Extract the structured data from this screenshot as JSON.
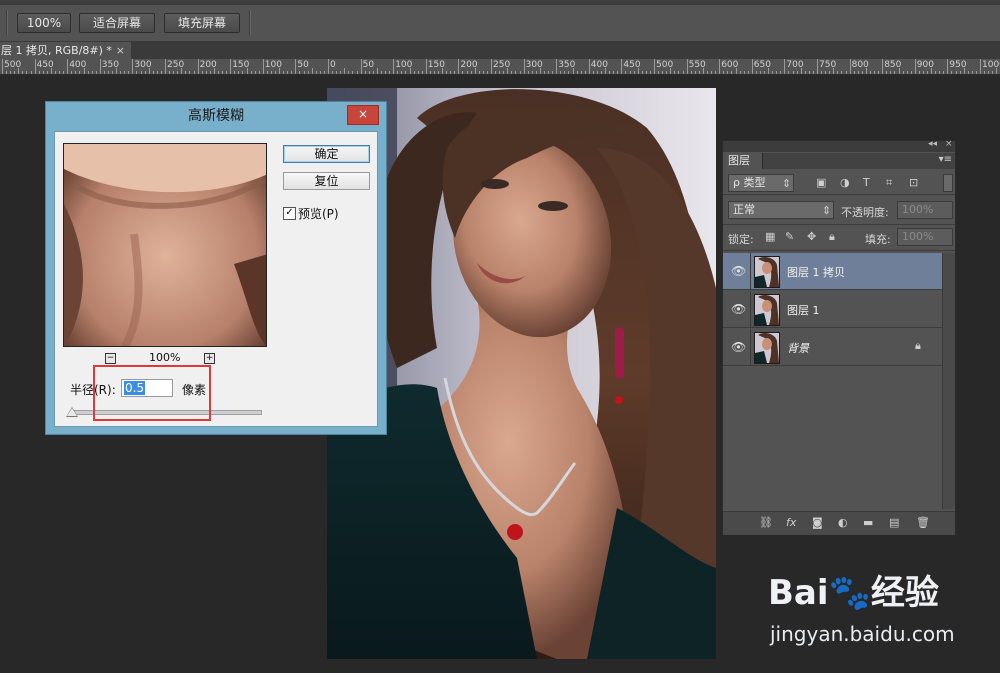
{
  "options_bar": {
    "btn_100": "100%",
    "btn_fit": "适合屏幕",
    "btn_fill": "填充屏幕"
  },
  "doc_tab": {
    "label": "层 1 拷贝, RGB/8#) *",
    "close": "×"
  },
  "ruler": {
    "labels": [
      "500",
      "450",
      "400",
      "350",
      "300",
      "250",
      "200",
      "150",
      "100",
      "50",
      "0",
      "50",
      "100",
      "150",
      "200",
      "250",
      "300",
      "350",
      "400",
      "450",
      "500",
      "550",
      "600",
      "650",
      "700",
      "750",
      "800",
      "850",
      "900",
      "950",
      "1000"
    ]
  },
  "dialog": {
    "title": "高斯模糊",
    "close": "×",
    "ok": "确定",
    "reset": "复位",
    "preview_label": "预览(P)",
    "preview_checked": "✓",
    "zoom_out": "−",
    "zoom_in": "+",
    "zoom": "100%",
    "radius_label": "半径(R):",
    "radius_value": "0.5",
    "radius_unit": "像素"
  },
  "layers_panel": {
    "collapse": "◂◂",
    "close": "×",
    "tab": "图层",
    "menu": "▾≡",
    "filter_kind": "ρ 类型",
    "blend_mode": "正常",
    "opacity_label": "不透明度:",
    "opacity_value": "100%",
    "lock_label": "锁定:",
    "fill_label": "填充:",
    "fill_value": "100%",
    "layers": [
      {
        "name": "图层 1 拷贝",
        "selected": true,
        "locked": false
      },
      {
        "name": "图层 1",
        "selected": false,
        "locked": false
      },
      {
        "name": "背景",
        "selected": false,
        "locked": true
      }
    ]
  },
  "watermark": {
    "brand": "Bai🐾经验",
    "url": "jingyan.baidu.com"
  }
}
